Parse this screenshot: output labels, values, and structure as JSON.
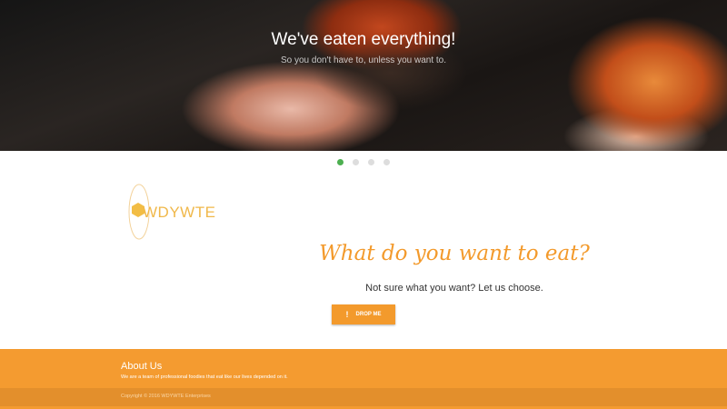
{
  "hero": {
    "title": "We've eaten everything!",
    "subtitle": "So you don't have to, unless you want to."
  },
  "carousel": {
    "count": 4,
    "active": 0
  },
  "logo": {
    "text": "WDYWTE"
  },
  "main": {
    "heading": "What do you want to eat?",
    "subtext": "Not sure what you want? Let us choose.",
    "button_icon": "!",
    "button_label": "DROP ME"
  },
  "footer": {
    "about_title": "About Us",
    "about_text": "We are a team of professional foodies that eat like our lives depended on it.",
    "copyright": "Copyright © 2016 WDYWTE Enterprises"
  },
  "colors": {
    "accent": "#f39a2c",
    "active_dot": "#4caf50"
  }
}
